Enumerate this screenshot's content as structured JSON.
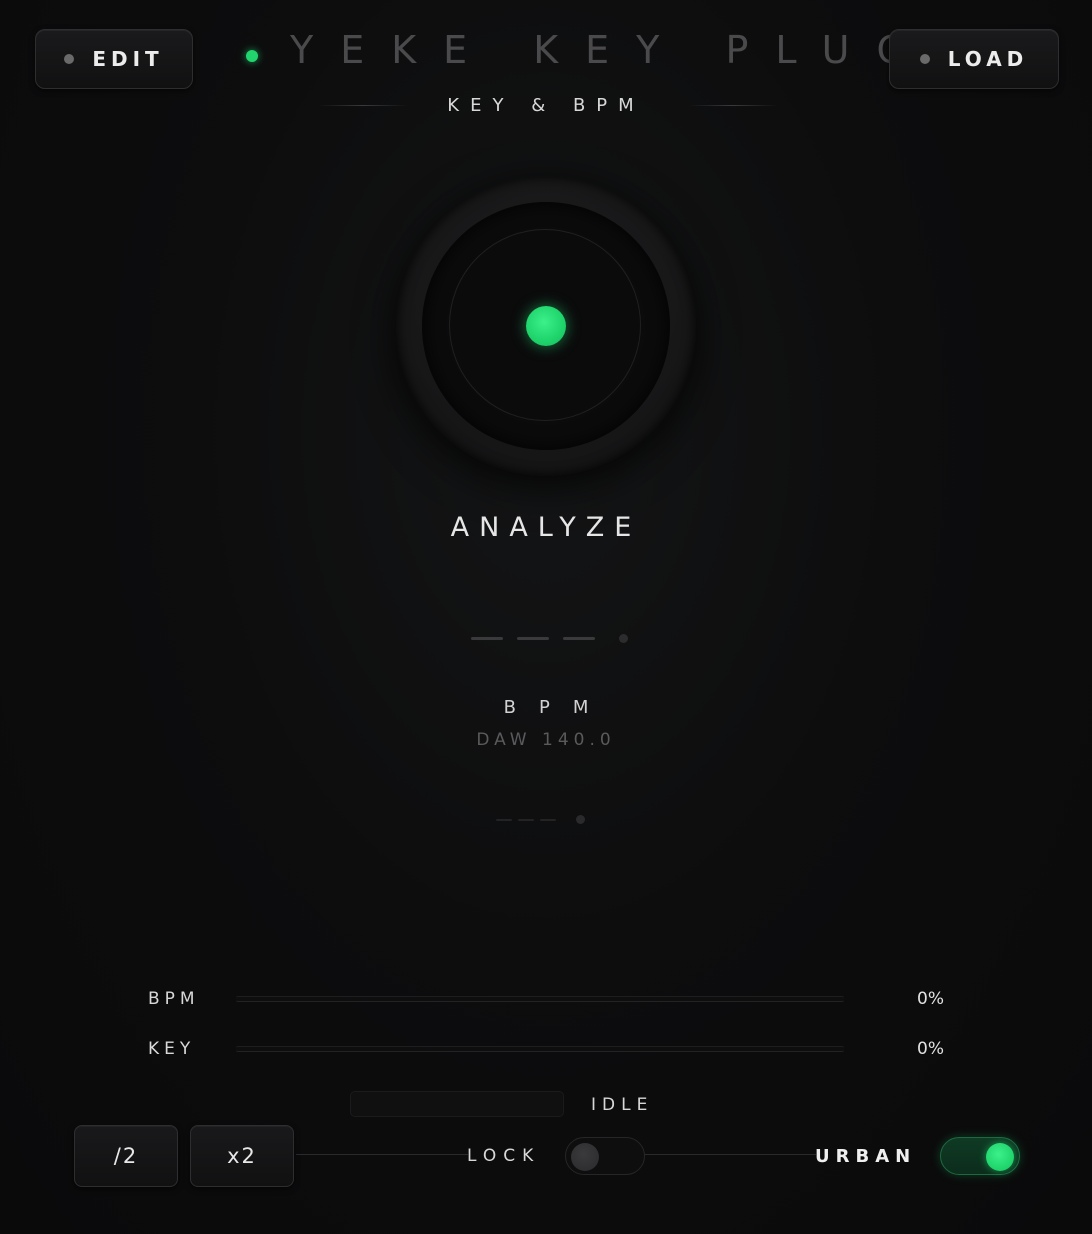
{
  "header": {
    "edit_label": "EDIT",
    "load_label": "LOAD",
    "title": "YEKE KEY PLUG",
    "subtitle": "KEY & BPM"
  },
  "analyze": {
    "label": "ANALYZE"
  },
  "bpm": {
    "label": "BPM",
    "daw_value": "DAW 140.0"
  },
  "confidence": {
    "bpm": {
      "label": "BPM",
      "percent_text": "0%",
      "value": 0
    },
    "key": {
      "label": "KEY",
      "percent_text": "0%",
      "value": 0
    }
  },
  "status": {
    "text": "IDLE"
  },
  "controls": {
    "half_label": "/2",
    "double_label": "x2",
    "lock_label": "LOCK",
    "lock_on": false,
    "urban_label": "URBAN",
    "urban_on": true
  },
  "colors": {
    "accent": "#21d46e",
    "background": "#0c0c0d",
    "panel_border": "#2e2e30"
  },
  "icons": {
    "status_led": "green-dot",
    "button_led": "gray-dot"
  }
}
